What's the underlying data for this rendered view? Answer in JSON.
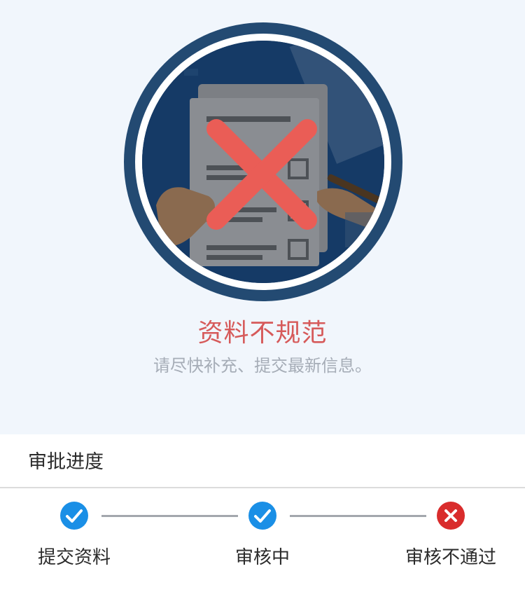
{
  "status": {
    "title": "资料不规范",
    "description": "请尽快补充、提交最新信息。"
  },
  "progress": {
    "section_title": "审批进度",
    "steps": [
      {
        "label": "提交资料",
        "state": "done"
      },
      {
        "label": "审核中",
        "state": "done"
      },
      {
        "label": "审核不通过",
        "state": "rejected"
      }
    ]
  },
  "colors": {
    "done": "#1a8fe6",
    "rejected": "#d92c2c",
    "error_text": "#d65a5a",
    "ring": "#234a72",
    "connector": "#a3a7ad"
  },
  "icons": {
    "status": "rejected-document-illustration",
    "done": "check-circle-icon",
    "rejected": "close-circle-icon"
  }
}
